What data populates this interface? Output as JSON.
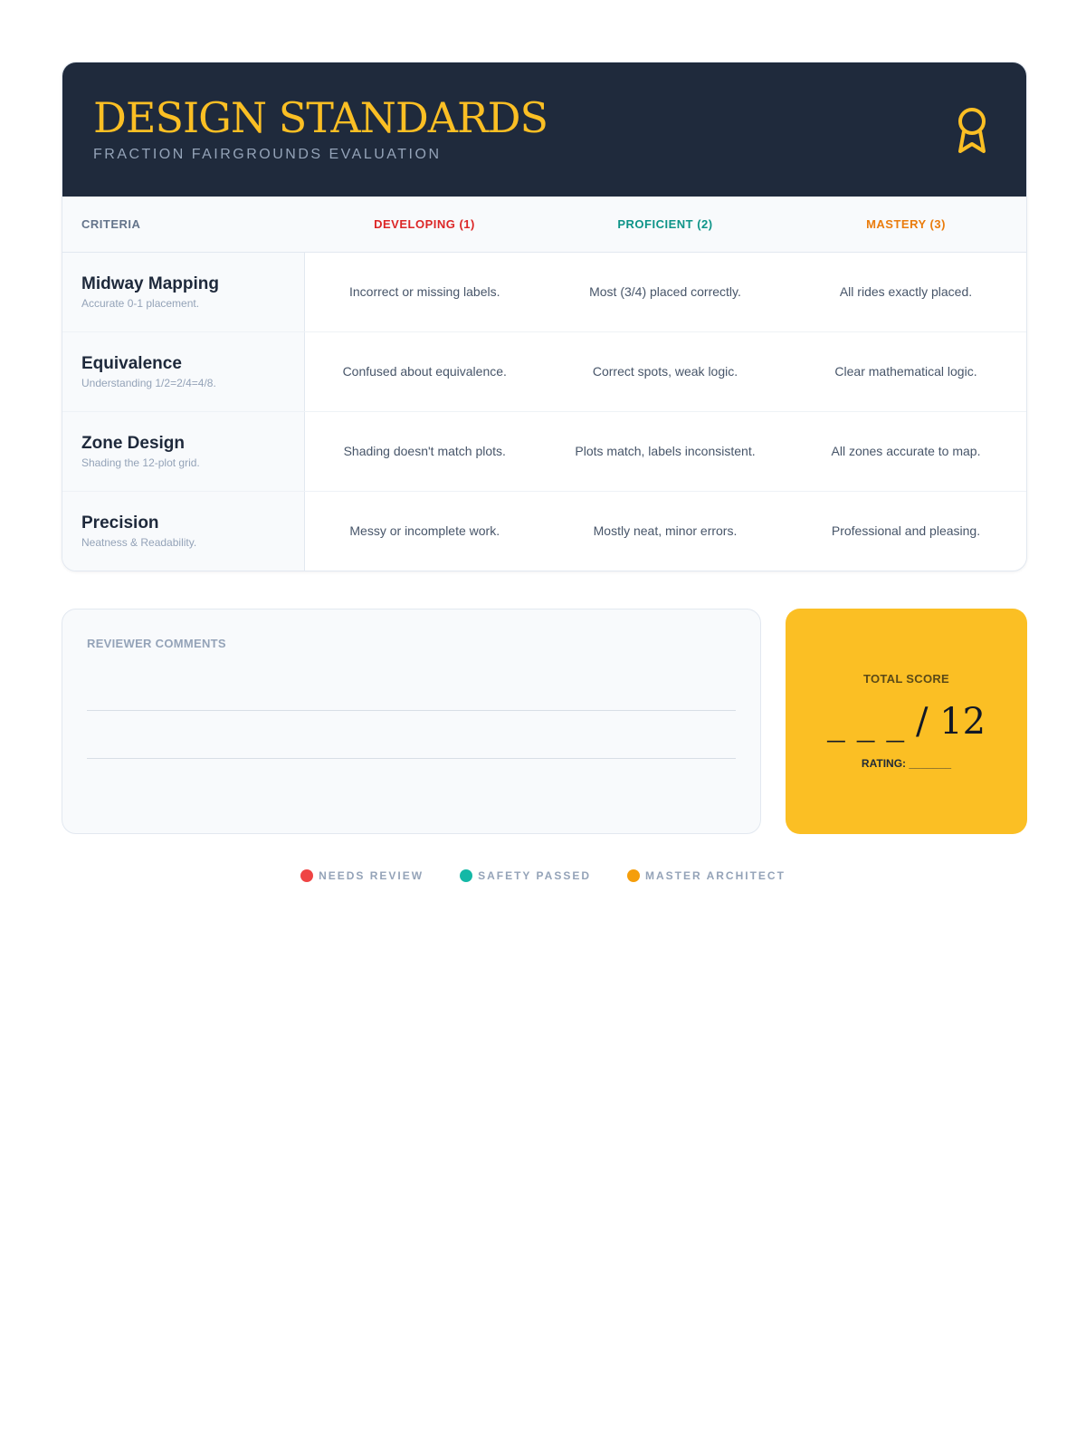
{
  "header": {
    "title": "DESIGN STANDARDS",
    "subtitle": "FRACTION FAIRGROUNDS EVALUATION",
    "icon": "award-ribbon-icon",
    "accent_color": "#fbbf24",
    "background_color": "#1f2a3c"
  },
  "table": {
    "columns": [
      "CRITERIA",
      "DEVELOPING (1)",
      "PROFICIENT (2)",
      "MASTERY (3)"
    ],
    "column_colors": [
      "#64748b",
      "#dc2626",
      "#0d9488",
      "#ea7c0c"
    ],
    "rows": [
      {
        "name": "Midway Mapping",
        "description": "Accurate 0-1 placement.",
        "developing": "Incorrect or missing labels.",
        "proficient": "Most (3/4) placed correctly.",
        "mastery": "All rides exactly placed."
      },
      {
        "name": "Equivalence",
        "description": "Understanding 1/2=2/4=4/8.",
        "developing": "Confused about equivalence.",
        "proficient": "Correct spots, weak logic.",
        "mastery": "Clear mathematical logic."
      },
      {
        "name": "Zone Design",
        "description": "Shading the 12-plot grid.",
        "developing": "Shading doesn't match plots.",
        "proficient": "Plots match, labels inconsistent.",
        "mastery": "All zones accurate to map."
      },
      {
        "name": "Precision",
        "description": "Neatness & Readability.",
        "developing": "Messy or incomplete work.",
        "proficient": "Mostly neat, minor errors.",
        "mastery": "Professional and pleasing."
      }
    ]
  },
  "comments": {
    "label": "REVIEWER COMMENTS"
  },
  "score": {
    "label": "TOTAL SCORE",
    "value": "_ _ _  / 12",
    "rating": "RATING: _______",
    "background_color": "#fbbf24"
  },
  "legend": [
    {
      "label": "NEEDS REVIEW",
      "color": "#ef4444"
    },
    {
      "label": "SAFETY PASSED",
      "color": "#14b8a6"
    },
    {
      "label": "MASTER ARCHITECT",
      "color": "#f59e0b"
    }
  ]
}
